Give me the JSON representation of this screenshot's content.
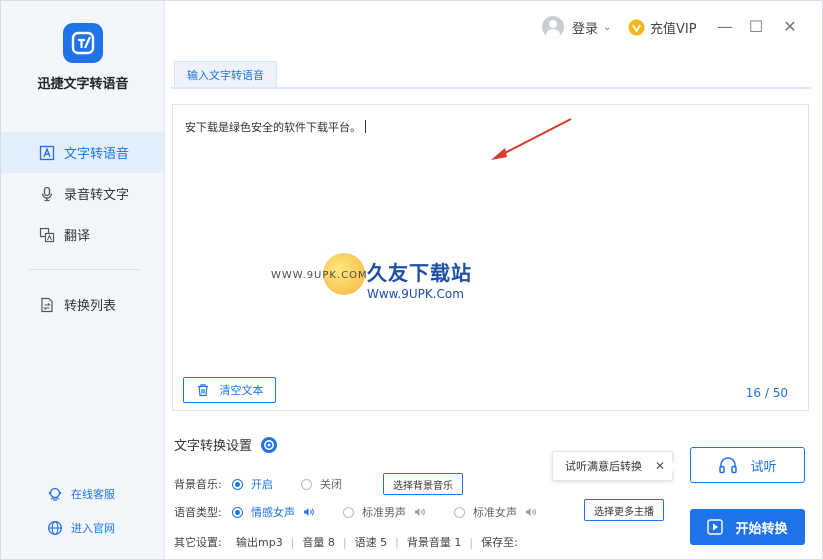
{
  "app": {
    "name": "迅捷文字转语音",
    "accent": "#1e73e8"
  },
  "sidebar": {
    "items": [
      {
        "label": "文字转语音",
        "icon": "text-icon",
        "active": true
      },
      {
        "label": "录音转文字",
        "icon": "microphone-icon",
        "active": false
      },
      {
        "label": "翻译",
        "icon": "translate-icon",
        "active": false
      },
      {
        "label": "转换列表",
        "icon": "convert-list-icon",
        "active": false
      }
    ],
    "links": [
      {
        "label": "在线客服",
        "icon": "customer-service-icon"
      },
      {
        "label": "进入官网",
        "icon": "globe-icon"
      }
    ]
  },
  "header": {
    "login_label": "登录",
    "vip_label": "充值VIP",
    "minimize": "—",
    "maximize": "☐",
    "close": "✕"
  },
  "tab": {
    "label": "输入文字转语音"
  },
  "editor": {
    "text": "安下载是绿色安全的软件下载平台。",
    "clear_label": "清空文本",
    "counter": "16 / 50"
  },
  "watermark": {
    "small": "WWW.9UPK.COM",
    "brand": "久友下载站",
    "url": "Www.9UPK.Com"
  },
  "settings": {
    "title": "文字转换设置",
    "bg_music": {
      "label": "背景音乐:",
      "options": [
        "开启",
        "关闭"
      ],
      "selected": "开启",
      "choose_label": "选择背景音乐"
    },
    "voice_type": {
      "label": "语音类型:",
      "options": [
        "情感女声",
        "标准男声",
        "标准女声"
      ],
      "selected": "情感女声",
      "more_label": "选择更多主播"
    },
    "other": {
      "label": "其它设置:",
      "items": [
        "输出mp3",
        "音量 8",
        "语速 5",
        "背景音量 1",
        "保存至:"
      ]
    }
  },
  "tooltip": {
    "text": "试听满意后转换",
    "close": "✕"
  },
  "buttons": {
    "listen": "试听",
    "start": "开始转换"
  }
}
